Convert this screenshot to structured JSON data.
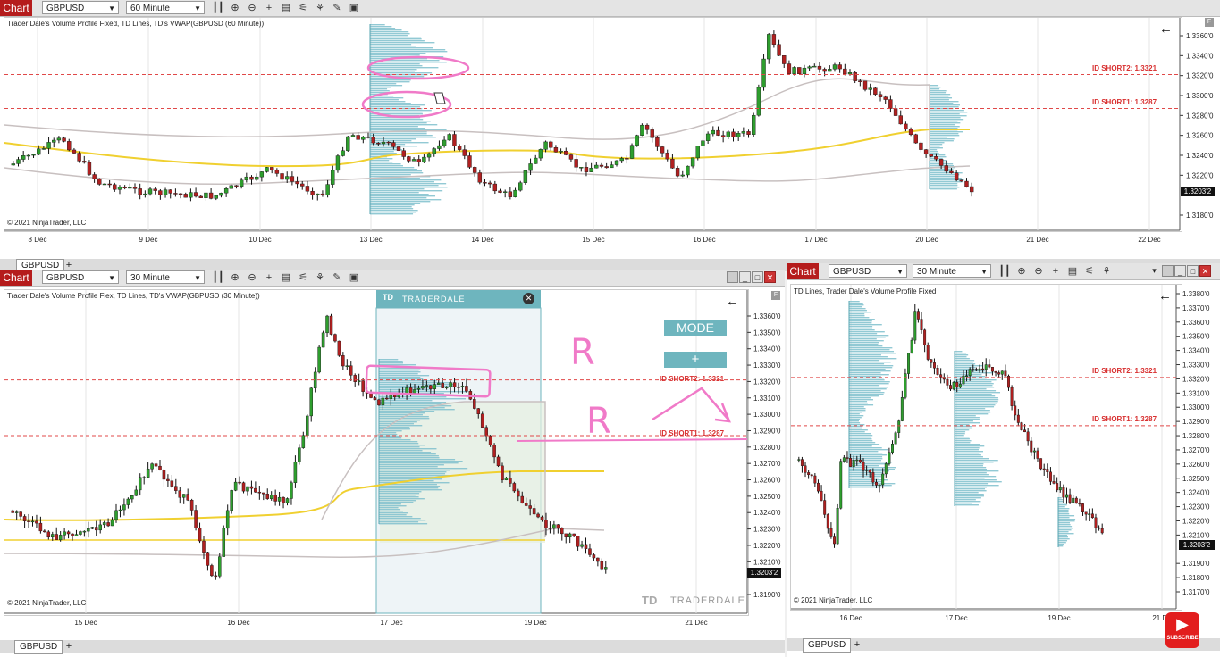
{
  "top": {
    "chart_button": "Chart",
    "instrument": "GBPUSD",
    "interval": "60 Minute",
    "caption": "Trader Dale's Volume Profile Fixed, TD Lines, TD's VWAP(GBPUSD (60 Minute))",
    "copyright": "© 2021 NinjaTrader, LLC",
    "tab": "GBPUSD",
    "price_ticks": [
      "1.3360'0",
      "1.3340'0",
      "1.3320'0",
      "1.3300'0",
      "1.3280'0",
      "1.3260'0",
      "1.3240'0",
      "1.3220'0",
      "1.3180'0"
    ],
    "last_price": "1.3203'2",
    "date_ticks": [
      "8 Dec",
      "9 Dec",
      "10 Dec",
      "13 Dec",
      "14 Dec",
      "15 Dec",
      "16 Dec",
      "17 Dec",
      "20 Dec",
      "21 Dec",
      "22 Dec"
    ],
    "levels": [
      "ID SHORT2: 1.3321",
      "ID SHORT1: 1.3287"
    ]
  },
  "bottom_left": {
    "chart_button": "Chart",
    "instrument": "GBPUSD",
    "interval": "30 Minute",
    "caption": "Trader Dale's Volume Profile Flex, TD Lines, TD's VWAP(GBPUSD (30 Minute))",
    "copyright": "© 2021 NinjaTrader, LLC",
    "tab": "GBPUSD",
    "price_ticks": [
      "1.3360'0",
      "1.3350'0",
      "1.3340'0",
      "1.3330'0",
      "1.3320'0",
      "1.3310'0",
      "1.3300'0",
      "1.3290'0",
      "1.3280'0",
      "1.3270'0",
      "1.3260'0",
      "1.3250'0",
      "1.3240'0",
      "1.3230'0",
      "1.3220'0",
      "1.3210'0",
      "1.3190'0"
    ],
    "last_price": "1.3203'2",
    "date_ticks": [
      "15 Dec",
      "16 Dec",
      "17 Dec",
      "19 Dec",
      "21 Dec"
    ],
    "levels": [
      "ID SHORT2: 1.3321",
      "ID SHORT1: 1.3287"
    ],
    "mode_label": "MODE",
    "plus_label": "+",
    "panel_brand": "TRADERDALE",
    "watermark": "TRADERDALE",
    "annotations": [
      "R",
      "R"
    ]
  },
  "bottom_right": {
    "chart_button": "Chart",
    "instrument": "GBPUSD",
    "interval": "30 Minute",
    "caption": "TD Lines, Trader Dale's Volume Profile Fixed",
    "copyright": "© 2021 NinjaTrader, LLC",
    "tab": "GBPUSD",
    "price_ticks": [
      "1.3380'0",
      "1.3370'0",
      "1.3360'0",
      "1.3350'0",
      "1.3340'0",
      "1.3330'0",
      "1.3320'0",
      "1.3310'0",
      "1.3300'0",
      "1.3290'0",
      "1.3280'0",
      "1.3270'0",
      "1.3260'0",
      "1.3250'0",
      "1.3240'0",
      "1.3230'0",
      "1.3220'0",
      "1.3210'0",
      "1.3190'0",
      "1.3180'0",
      "1.3170'0"
    ],
    "last_price": "1.3203'2",
    "date_ticks": [
      "16 Dec",
      "17 Dec",
      "19 Dec",
      "21 De"
    ],
    "levels": [
      "ID SHORT2: 1.3321",
      "ID SHORT1: 1.3287"
    ]
  },
  "subscribe": "SUBSCRIBE",
  "colors": {
    "chart_red": "#b51c1c",
    "bull": "#2e9e2e",
    "bear": "#b02020",
    "profile": "#7fbfcc",
    "level_line": "#e04848",
    "vwap": "#f0d030",
    "band": "#c8c0c0",
    "annotation": "#f07ac8"
  }
}
